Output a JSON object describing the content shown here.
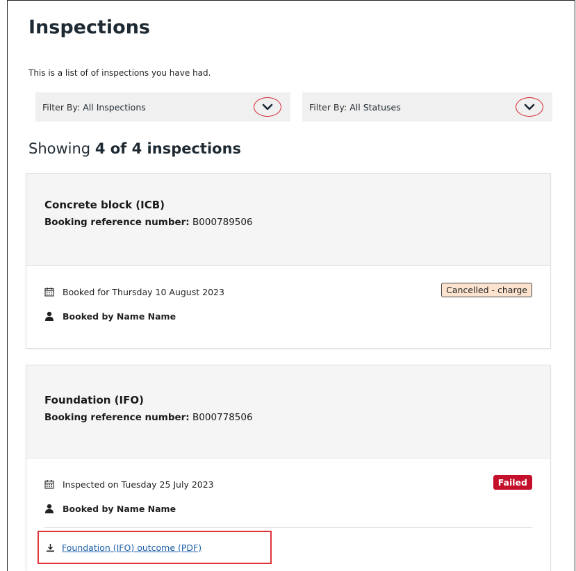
{
  "page": {
    "title": "Inspections",
    "intro": "This is a list of of inspections you have had."
  },
  "filters": [
    {
      "label": "Filter By:",
      "value": "All Inspections"
    },
    {
      "label": "Filter By:",
      "value": "All Statuses"
    }
  ],
  "results": {
    "prefix": "Showing",
    "count": "4 of 4 inspections"
  },
  "cards": [
    {
      "title": "Concrete block (ICB)",
      "ref_label": "Booking reference number:",
      "ref_value": "B000789506",
      "date_text": "Booked for Thursday 10 August 2023",
      "booked_by": "Booked by Name Name",
      "status": "Cancelled - charge"
    },
    {
      "title": "Foundation (IFO)",
      "ref_label": "Booking reference number:",
      "ref_value": "B000778506",
      "date_text": "Inspected on Tuesday 25 July 2023",
      "booked_by": "Booked by Name Name",
      "status": "Failed",
      "download_link": "Foundation (IFO) outcome (PDF)"
    }
  ],
  "colors": {
    "failed_badge": "#c4102a",
    "cancelled_badge": "#fbe3cf",
    "link": "#1b5fa8",
    "highlight": "#e0343a"
  },
  "icons": [
    "chevron-down-icon",
    "calendar-icon",
    "user-icon",
    "download-icon"
  ]
}
